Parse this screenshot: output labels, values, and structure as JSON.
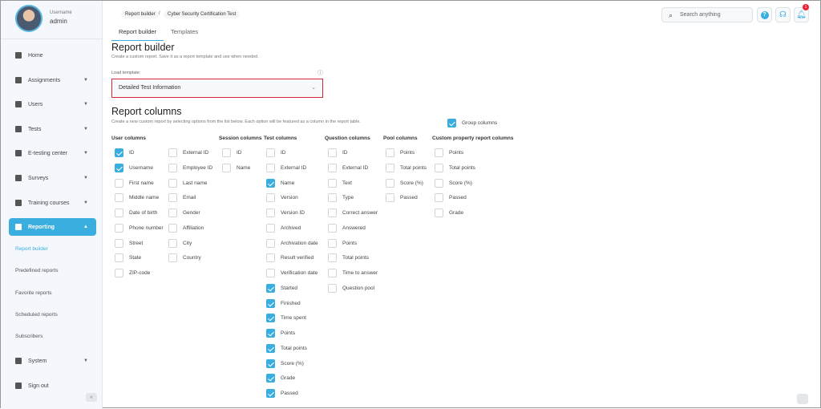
{
  "user": {
    "label": "Username",
    "name": "admin"
  },
  "nav": [
    {
      "label": "Home",
      "icon": "home-icon",
      "caret": false
    },
    {
      "label": "Assignments",
      "icon": "assignments-icon",
      "caret": true
    },
    {
      "label": "Users",
      "icon": "users-icon",
      "caret": true
    },
    {
      "label": "Tests",
      "icon": "tests-icon",
      "caret": true
    },
    {
      "label": "E-testing center",
      "icon": "testing-center-icon",
      "caret": true
    },
    {
      "label": "Surveys",
      "icon": "surveys-icon",
      "caret": true
    },
    {
      "label": "Training courses",
      "icon": "courses-icon",
      "caret": true
    },
    {
      "label": "Reporting",
      "icon": "reporting-icon",
      "caret": true,
      "active": true
    }
  ],
  "reporting_sub": [
    "Report builder",
    "Predefined reports",
    "Favorite reports",
    "Scheduled reports",
    "Subscribers"
  ],
  "nav_bottom": [
    {
      "label": "System",
      "icon": "gear-icon",
      "caret": true
    },
    {
      "label": "Sign out",
      "icon": "sign-out-icon",
      "caret": false
    }
  ],
  "breadcrumb": [
    "Report builder",
    "Cyber Security Certification Test"
  ],
  "tabs": [
    "Report builder",
    "Templates"
  ],
  "search": {
    "placeholder": "Search anything"
  },
  "notifications_count": "1",
  "page": {
    "title": "Report builder",
    "subtitle": "Create a custom report.  Save it as a report template and use when needed.",
    "load_template_label": "Load template:",
    "template_value": "Detailed Test Information",
    "columns_title": "Report columns",
    "columns_desc": "Create a new custom report by selecting options from the list below. Each option will be featured as a column in the report table.",
    "group_columns": {
      "label": "Group columns",
      "checked": true
    }
  },
  "column_groups": [
    {
      "title": "User columns",
      "items": [
        {
          "label": "ID",
          "checked": true
        },
        {
          "label": "Username",
          "checked": true
        },
        {
          "label": "First name"
        },
        {
          "label": "Middle name"
        },
        {
          "label": "Date of birth"
        },
        {
          "label": "Phone number"
        },
        {
          "label": "Street"
        },
        {
          "label": "State"
        },
        {
          "label": "ZIP-code"
        }
      ]
    },
    {
      "title": "",
      "items": [
        {
          "label": "External ID"
        },
        {
          "label": "Employee ID"
        },
        {
          "label": "Last name"
        },
        {
          "label": "Email"
        },
        {
          "label": "Gender"
        },
        {
          "label": "Affiliation"
        },
        {
          "label": "City"
        },
        {
          "label": "Country"
        }
      ]
    },
    {
      "title": "Session columns",
      "items": [
        {
          "label": "ID"
        },
        {
          "label": "Name"
        }
      ]
    },
    {
      "title": "Test columns",
      "items": [
        {
          "label": "ID"
        },
        {
          "label": "External ID"
        },
        {
          "label": "Name",
          "checked": true
        },
        {
          "label": "Version"
        },
        {
          "label": "Version ID"
        },
        {
          "label": "Archived"
        },
        {
          "label": "Archivation date"
        },
        {
          "label": "Result verified"
        },
        {
          "label": "Verification date"
        },
        {
          "label": "Started",
          "checked": true
        },
        {
          "label": "Finished",
          "checked": true
        },
        {
          "label": "Time spent",
          "checked": true
        },
        {
          "label": "Points",
          "checked": true
        },
        {
          "label": "Total points",
          "checked": true
        },
        {
          "label": "Score (%)",
          "checked": true
        },
        {
          "label": "Grade",
          "checked": true
        },
        {
          "label": "Passed",
          "checked": true
        }
      ]
    },
    {
      "title": "Question columns",
      "items": [
        {
          "label": "ID"
        },
        {
          "label": "External ID"
        },
        {
          "label": "Text"
        },
        {
          "label": "Type"
        },
        {
          "label": "Correct answer"
        },
        {
          "label": "Answered"
        },
        {
          "label": "Points"
        },
        {
          "label": "Total points"
        },
        {
          "label": "Time to answer"
        },
        {
          "label": "Question pool"
        }
      ]
    },
    {
      "title": "Pool columns",
      "items": [
        {
          "label": "Points"
        },
        {
          "label": "Total points"
        },
        {
          "label": "Score (%)"
        },
        {
          "label": "Passed"
        }
      ]
    },
    {
      "title": "Custom property report columns",
      "items": [
        {
          "label": "Points"
        },
        {
          "label": "Total points"
        },
        {
          "label": "Score (%)"
        },
        {
          "label": "Passed"
        },
        {
          "label": "Grade"
        }
      ]
    }
  ]
}
